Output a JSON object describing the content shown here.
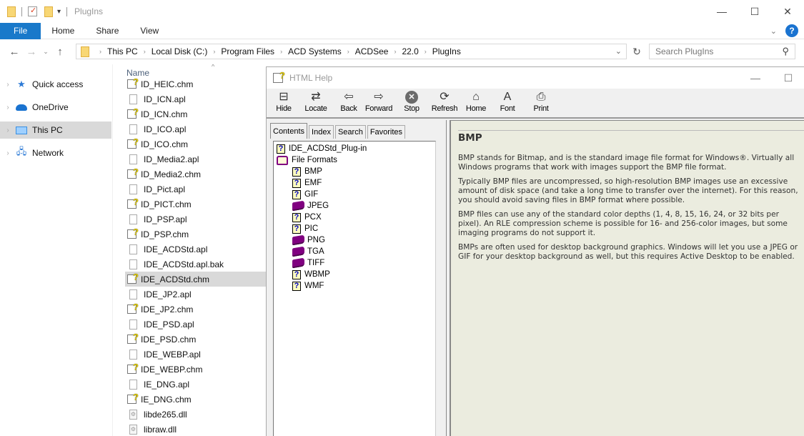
{
  "explorer": {
    "title": "PlugIns",
    "ribbon_tabs": [
      "File",
      "Home",
      "Share",
      "View"
    ],
    "breadcrumb": [
      "This PC",
      "Local Disk (C:)",
      "Program Files",
      "ACD Systems",
      "ACDSee",
      "22.0",
      "PlugIns"
    ],
    "search_placeholder": "Search PlugIns",
    "window_controls": {
      "minimize": "—",
      "maximize": "☐",
      "close": "✕"
    },
    "help_glyph": "?",
    "nav_pane": [
      {
        "label": "Quick access",
        "icon": "star-icon"
      },
      {
        "label": "OneDrive",
        "icon": "cloud-icon"
      },
      {
        "label": "This PC",
        "icon": "monitor-icon",
        "selected": true
      },
      {
        "label": "Network",
        "icon": "network-icon"
      }
    ],
    "column_header": "Name",
    "files": [
      {
        "name": "ID_HEIC.chm",
        "type": "chm"
      },
      {
        "name": "ID_ICN.apl",
        "type": "doc"
      },
      {
        "name": "ID_ICN.chm",
        "type": "chm"
      },
      {
        "name": "ID_ICO.apl",
        "type": "doc"
      },
      {
        "name": "ID_ICO.chm",
        "type": "chm"
      },
      {
        "name": "ID_Media2.apl",
        "type": "doc"
      },
      {
        "name": "ID_Media2.chm",
        "type": "chm"
      },
      {
        "name": "ID_Pict.apl",
        "type": "doc"
      },
      {
        "name": "ID_PICT.chm",
        "type": "chm"
      },
      {
        "name": "ID_PSP.apl",
        "type": "doc"
      },
      {
        "name": "ID_PSP.chm",
        "type": "chm"
      },
      {
        "name": "IDE_ACDStd.apl",
        "type": "doc"
      },
      {
        "name": "IDE_ACDStd.apl.bak",
        "type": "doc"
      },
      {
        "name": "IDE_ACDStd.chm",
        "type": "chm",
        "selected": true
      },
      {
        "name": "IDE_JP2.apl",
        "type": "doc"
      },
      {
        "name": "IDE_JP2.chm",
        "type": "chm"
      },
      {
        "name": "IDE_PSD.apl",
        "type": "doc"
      },
      {
        "name": "IDE_PSD.chm",
        "type": "chm"
      },
      {
        "name": "IDE_WEBP.apl",
        "type": "doc"
      },
      {
        "name": "IDE_WEBP.chm",
        "type": "chm"
      },
      {
        "name": "IE_DNG.apl",
        "type": "doc"
      },
      {
        "name": "IE_DNG.chm",
        "type": "chm"
      },
      {
        "name": "libde265.dll",
        "type": "dll"
      },
      {
        "name": "libraw.dll",
        "type": "dll"
      }
    ]
  },
  "help": {
    "title": "HTML Help",
    "toolbar": [
      {
        "label": "Hide",
        "icon": "hide-pane-icon",
        "glyph": "⊟"
      },
      {
        "label": "Locate",
        "icon": "locate-icon",
        "glyph": "⇄"
      },
      {
        "label": "Back",
        "icon": "back-arrow-icon",
        "glyph": "⇦"
      },
      {
        "label": "Forward",
        "icon": "forward-arrow-icon",
        "glyph": "⇨"
      },
      {
        "label": "Stop",
        "icon": "stop-icon",
        "glyph": "✕"
      },
      {
        "label": "Refresh",
        "icon": "refresh-icon",
        "glyph": "⟳"
      },
      {
        "label": "Home",
        "icon": "home-icon",
        "glyph": "⌂"
      },
      {
        "label": "Font",
        "icon": "font-icon",
        "glyph": "A"
      },
      {
        "label": "Print",
        "icon": "printer-icon",
        "glyph": "⎙"
      }
    ],
    "tabs": [
      "Contents",
      "Index",
      "Search",
      "Favorites"
    ],
    "active_tab": "Contents",
    "toc": [
      {
        "label": "IDE_ACDStd_Plug-in",
        "kind": "topic",
        "level": 0
      },
      {
        "label": "File Formats",
        "kind": "book-open",
        "level": 0
      },
      {
        "label": "BMP",
        "kind": "topic",
        "level": 1
      },
      {
        "label": "EMF",
        "kind": "topic",
        "level": 1
      },
      {
        "label": "GIF",
        "kind": "topic",
        "level": 1
      },
      {
        "label": "JPEG",
        "kind": "book",
        "level": 1
      },
      {
        "label": "PCX",
        "kind": "topic",
        "level": 1
      },
      {
        "label": "PIC",
        "kind": "topic",
        "level": 1
      },
      {
        "label": "PNG",
        "kind": "book",
        "level": 1
      },
      {
        "label": "TGA",
        "kind": "book",
        "level": 1
      },
      {
        "label": "TIFF",
        "kind": "book",
        "level": 1
      },
      {
        "label": "WBMP",
        "kind": "topic",
        "level": 1
      },
      {
        "label": "WMF",
        "kind": "topic",
        "level": 1
      }
    ],
    "content": {
      "heading": "BMP",
      "paragraphs": [
        "BMP stands for Bitmap, and is the standard image file format for Windows®. Virtually all Windows programs that work with images support the BMP file format.",
        "Typically BMP files are uncompressed, so high-resolution BMP images use an excessive amount of disk space (and take a long time to transfer over the internet). For this reason, you should avoid saving files in BMP format where possible.",
        "BMP files can use any of the standard color depths (1, 4, 8, 15, 16, 24, or 32 bits per pixel). An RLE compression scheme is possible for 16- and 256-color images, but some imaging programs do not support it.",
        "BMPs are often used for desktop background graphics. Windows will let you use a JPEG or GIF for your desktop background as well, but this requires Active Desktop to be enabled."
      ]
    }
  },
  "colors": {
    "file_tab": "#1979ca",
    "selection": "#d9d9d9",
    "content_bg": "#ebecdf",
    "book": "#800080"
  }
}
